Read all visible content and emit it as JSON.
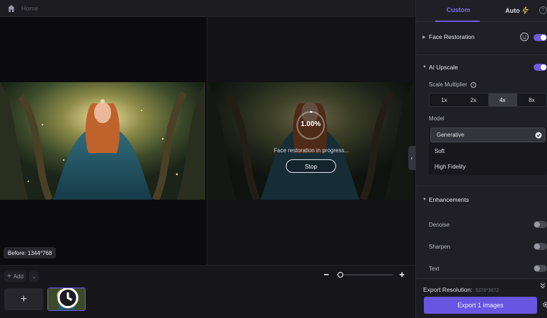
{
  "topbar": {
    "breadcrumb": "Home",
    "home_icon": "home-icon"
  },
  "canvas": {
    "progress_percent": "1.00%",
    "progress_value": 0.01,
    "progress_message": "Face restoration in progress...",
    "stop_label": "Stop",
    "before_label": "Before: 1344*768"
  },
  "bottom": {
    "add_label": "Add",
    "add_icon": "plus-icon",
    "add_dropdown_icon": "chevron-down-icon",
    "add_tile_glyph": "+",
    "zoom_minus": "−",
    "zoom_plus": "+",
    "zoom_level": 0.05
  },
  "panel": {
    "tabs": [
      {
        "label": "Custom",
        "active": true
      },
      {
        "label": "Auto",
        "icon": "lightning-icon"
      }
    ],
    "help_glyph": "?",
    "face_restoration": {
      "label": "Face Restoration",
      "enabled": true,
      "icon": "face-icon"
    },
    "ai_upscale": {
      "label": "AI Upscale",
      "enabled": true,
      "scale_label": "Scale Multiplier",
      "info_glyph": "i",
      "scale_options": [
        "1x",
        "2x",
        "4x",
        "8x"
      ],
      "scale_selected": "4x",
      "model_label": "Model",
      "models": [
        "Generative",
        "Soft",
        "High Fidelity"
      ],
      "model_selected": "Generative"
    },
    "enhancements": {
      "label": "Enhancements",
      "items": [
        {
          "label": "Denoise",
          "enabled": false
        },
        {
          "label": "Sharpen",
          "enabled": false
        },
        {
          "label": "Text",
          "enabled": false
        }
      ]
    },
    "export": {
      "resolution_label": "Export Resolution:",
      "resolution_value": "5376*3072",
      "button_label": "Export 1 images"
    }
  },
  "colors": {
    "accent": "#6f5ae0",
    "panel_bg": "#1f1f25",
    "canvas_bg": "#0b0b0e"
  }
}
